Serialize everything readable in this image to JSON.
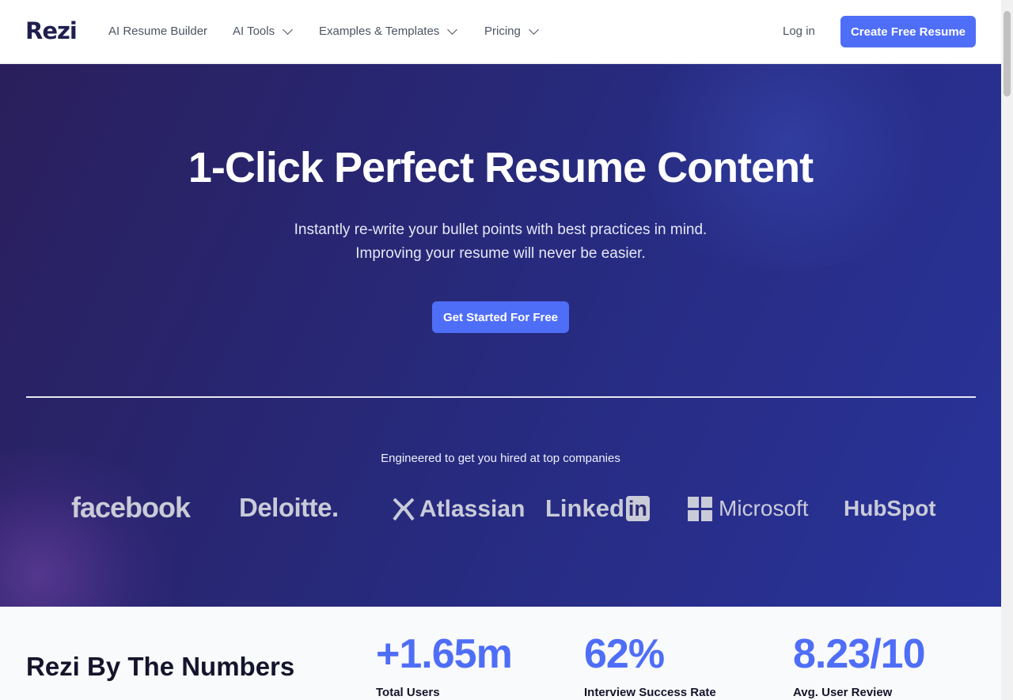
{
  "nav": {
    "logo": "Rezi",
    "links": [
      {
        "label": "AI Resume Builder"
      },
      {
        "label": "AI Tools"
      },
      {
        "label": "Examples & Templates"
      },
      {
        "label": "Pricing"
      }
    ],
    "login": "Log in",
    "cta": "Create Free Resume"
  },
  "hero": {
    "title": "1-Click Perfect Resume Content",
    "subtitle_line1": "Instantly re-write your bullet points with best practices in mind.",
    "subtitle_line2": "Improving your resume will never be easier.",
    "cta": "Get Started For Free",
    "engineered": "Engineered to get you hired at top companies",
    "companies": {
      "facebook": "facebook",
      "deloitte": "Deloitte.",
      "atlassian": "Atlassian",
      "linkedin_a": "Linked",
      "linkedin_b": "in",
      "microsoft": "Microsoft",
      "hubspot": "HubSpot"
    }
  },
  "numbers": {
    "title": "Rezi By The Numbers",
    "stats": [
      {
        "value": "+1.65m",
        "label": "Total Users"
      },
      {
        "value": "62%",
        "label": "Interview Success Rate"
      },
      {
        "value": "8.23/10",
        "label": "Avg. User Review"
      }
    ]
  },
  "colors": {
    "accent": "#4f6ef7",
    "hero_bg": "#272a7d"
  }
}
